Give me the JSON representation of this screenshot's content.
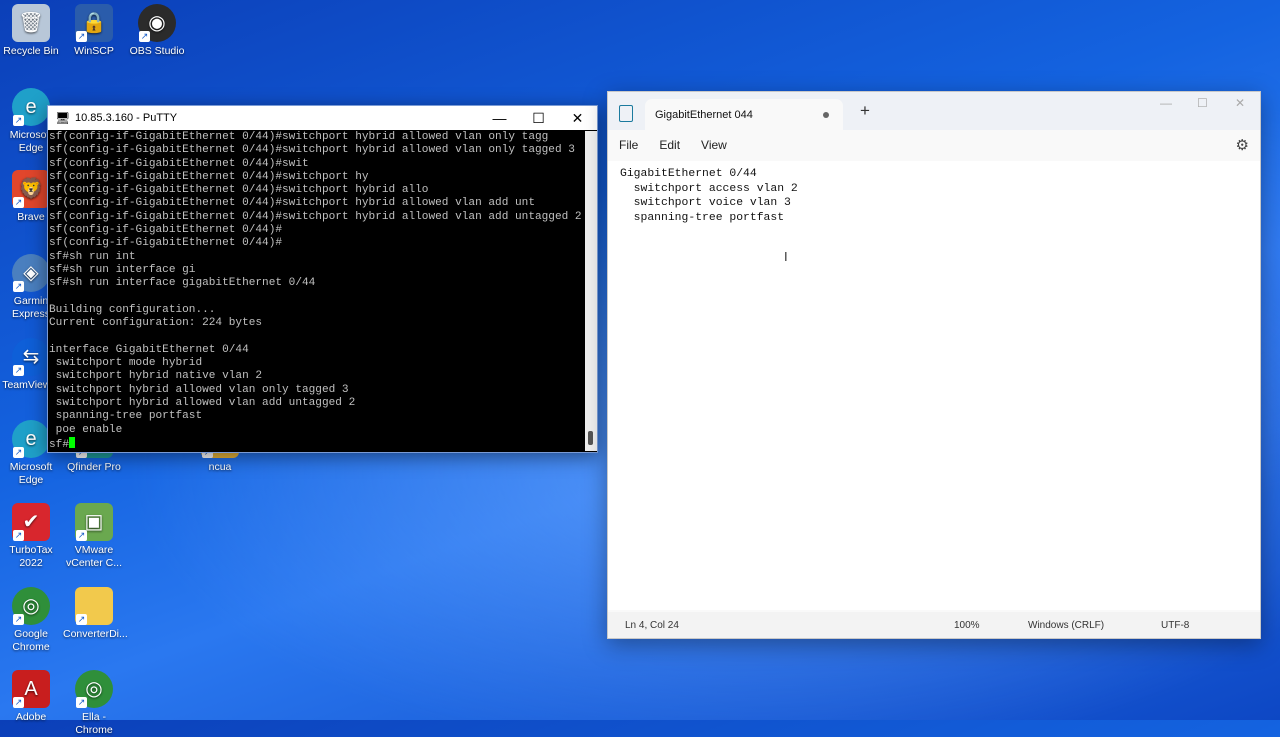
{
  "desktop": {
    "icons": [
      {
        "label": "Recycle Bin",
        "icon": "recycle-bin-icon",
        "color": "#b8c7d8"
      },
      {
        "label": "WinSCP",
        "icon": "winscp-icon",
        "color": "#2a5cab"
      },
      {
        "label": "OBS Studio",
        "icon": "obs-icon",
        "color": "#2b2b2b"
      },
      {
        "label": "Microsoft\nEdge",
        "icon": "edge-icon",
        "color": "#1fa0c9"
      },
      {
        "label": "Brave",
        "icon": "brave-icon",
        "color": "#e2462c"
      },
      {
        "label": "Garmin\nExpress",
        "icon": "garmin-icon",
        "color": "#4a7fbf"
      },
      {
        "label": "TeamViewer",
        "icon": "teamviewer-icon",
        "color": "#0e5fd8"
      },
      {
        "label": "Microsoft\nEdge",
        "icon": "edge-icon",
        "color": "#1fa0c9"
      },
      {
        "label": "Qfinder Pro",
        "icon": "qfinder-icon",
        "color": "#1d9c9a"
      },
      {
        "label": "ncua",
        "icon": "folder-icon",
        "color": "#e8b43a"
      },
      {
        "label": "TurboTax\n2022",
        "icon": "turbotax-icon",
        "color": "#d8262d"
      },
      {
        "label": "VMware\nvCenter C...",
        "icon": "vmware-icon",
        "color": "#6aa84f"
      },
      {
        "label": "Google\nChrome",
        "icon": "chrome-icon",
        "color": "#2f8f3a"
      },
      {
        "label": "ConverterDi...",
        "icon": "folder-icon",
        "color": "#f2c94c"
      },
      {
        "label": "Adobe",
        "icon": "acrobat-icon",
        "color": "#c81e1e"
      },
      {
        "label": "Ella - Chrome",
        "icon": "chrome-icon",
        "color": "#2f8f3a"
      }
    ]
  },
  "putty": {
    "title": "10.85.3.160 - PuTTY",
    "minimize": "—",
    "maximize": "☐",
    "close": "✕",
    "lines": [
      "sf(config-if-GigabitEthernet 0/44)#switchport hybrid allowed vlan only tagg",
      "sf(config-if-GigabitEthernet 0/44)#switchport hybrid allowed vlan only tagged 3",
      "sf(config-if-GigabitEthernet 0/44)#swit",
      "sf(config-if-GigabitEthernet 0/44)#switchport hy",
      "sf(config-if-GigabitEthernet 0/44)#switchport hybrid allo",
      "sf(config-if-GigabitEthernet 0/44)#switchport hybrid allowed vlan add unt",
      "sf(config-if-GigabitEthernet 0/44)#switchport hybrid allowed vlan add untagged 2",
      "sf(config-if-GigabitEthernet 0/44)#",
      "sf(config-if-GigabitEthernet 0/44)#",
      "sf#sh run int",
      "sf#sh run interface gi",
      "sf#sh run interface gigabitEthernet 0/44",
      "",
      "Building configuration...",
      "Current configuration: 224 bytes",
      "",
      "interface GigabitEthernet 0/44",
      " switchport mode hybrid",
      " switchport hybrid native vlan 2",
      " switchport hybrid allowed vlan only tagged 3",
      " switchport hybrid allowed vlan add untagged 2",
      " spanning-tree portfast",
      " poe enable"
    ],
    "prompt": "sf#",
    "cursor_color": "#00ff00"
  },
  "notepad": {
    "tab_title": "GigabitEthernet 044",
    "new_tab": "+",
    "menu": [
      "File",
      "Edit",
      "View"
    ],
    "content": "GigabitEthernet 0/44\n  switchport access vlan 2\n  switchport voice vlan 3\n  spanning-tree portfast",
    "status": {
      "position": "Ln 4, Col 24",
      "zoom": "100%",
      "line_ending": "Windows (CRLF)",
      "encoding": "UTF-8"
    }
  }
}
